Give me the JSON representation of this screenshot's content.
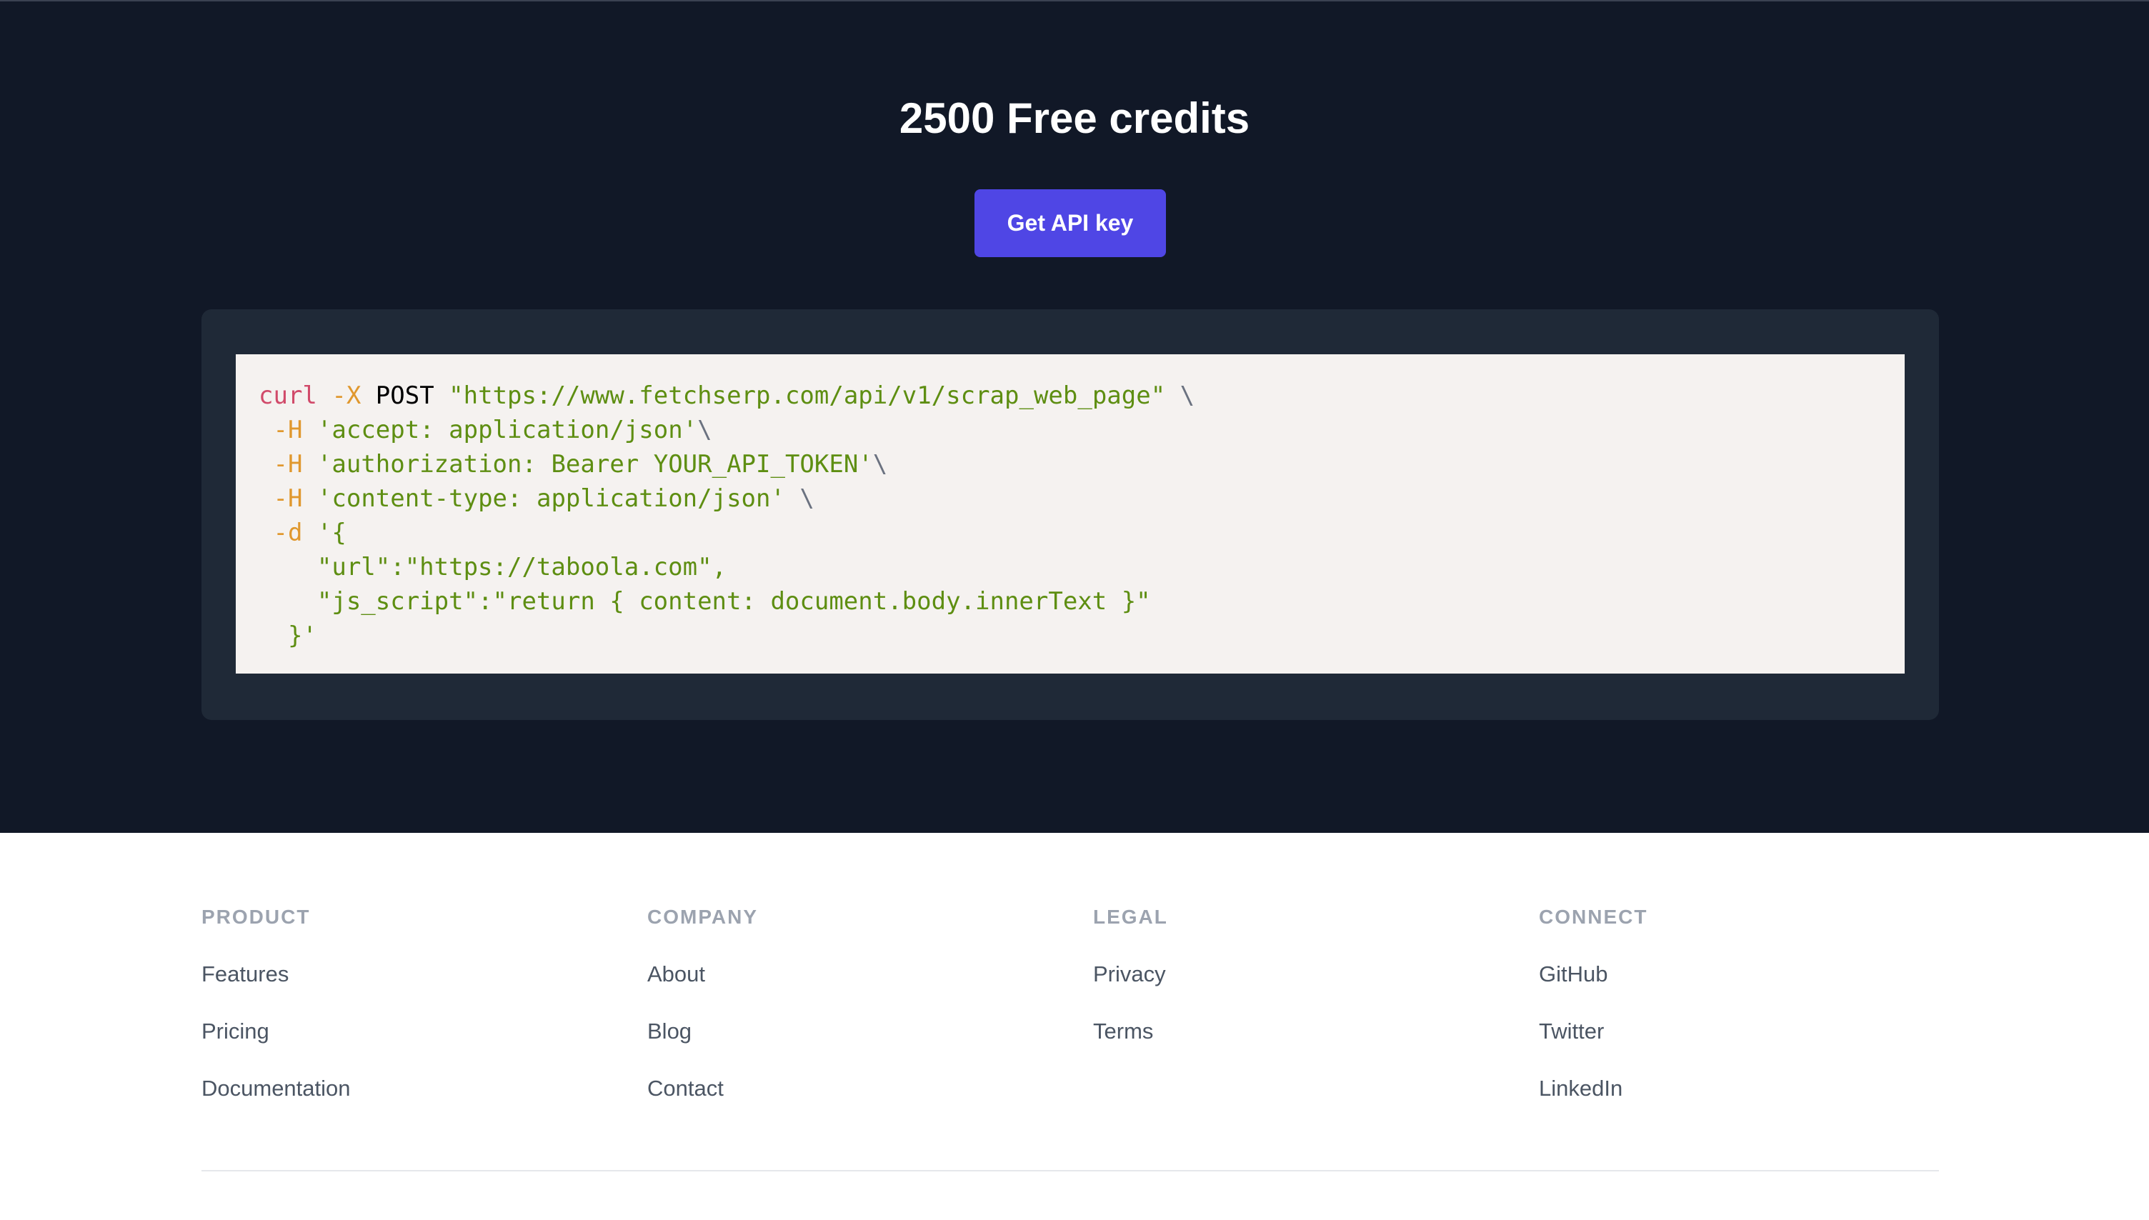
{
  "hero": {
    "title": "2500 Free credits",
    "cta_label": "Get API key"
  },
  "code": {
    "lines": [
      [
        {
          "t": "cmd",
          "v": "curl"
        },
        {
          "t": "kw",
          "v": " "
        },
        {
          "t": "flag",
          "v": "-X"
        },
        {
          "t": "kw",
          "v": " POST "
        },
        {
          "t": "str",
          "v": "\"https://www.fetchserp.com/api/v1/scrap_web_page\""
        },
        {
          "t": "punc",
          "v": " \\"
        }
      ],
      [
        {
          "t": "kw",
          "v": " "
        },
        {
          "t": "flag",
          "v": "-H"
        },
        {
          "t": "kw",
          "v": " "
        },
        {
          "t": "str",
          "v": "'accept: application/json'"
        },
        {
          "t": "punc",
          "v": "\\"
        }
      ],
      [
        {
          "t": "kw",
          "v": " "
        },
        {
          "t": "flag",
          "v": "-H"
        },
        {
          "t": "kw",
          "v": " "
        },
        {
          "t": "str",
          "v": "'authorization: Bearer YOUR_API_TOKEN'"
        },
        {
          "t": "punc",
          "v": "\\"
        }
      ],
      [
        {
          "t": "kw",
          "v": " "
        },
        {
          "t": "flag",
          "v": "-H"
        },
        {
          "t": "kw",
          "v": " "
        },
        {
          "t": "str",
          "v": "'content-type: application/json'"
        },
        {
          "t": "punc",
          "v": " \\"
        }
      ],
      [
        {
          "t": "kw",
          "v": " "
        },
        {
          "t": "flag",
          "v": "-d"
        },
        {
          "t": "kw",
          "v": " "
        },
        {
          "t": "str",
          "v": "'{"
        }
      ],
      [
        {
          "t": "str",
          "v": "    \"url\":\"https://taboola.com\","
        }
      ],
      [
        {
          "t": "str",
          "v": "    \"js_script\":\"return { content: document.body.innerText }\""
        }
      ],
      [
        {
          "t": "str",
          "v": "  }'"
        }
      ]
    ]
  },
  "footer": {
    "columns": [
      {
        "heading": "PRODUCT",
        "links": [
          "Features",
          "Pricing",
          "Documentation"
        ]
      },
      {
        "heading": "COMPANY",
        "links": [
          "About",
          "Blog",
          "Contact"
        ]
      },
      {
        "heading": "LEGAL",
        "links": [
          "Privacy",
          "Terms"
        ]
      },
      {
        "heading": "CONNECT",
        "links": [
          "GitHub",
          "Twitter",
          "LinkedIn"
        ]
      }
    ]
  },
  "colors": {
    "hero_bg": "#111827",
    "panel_bg": "#1f2937",
    "code_bg": "#f5f2f0",
    "accent": "#4f46e5",
    "code_cmd": "#d14a6a",
    "code_flag": "#e0982e",
    "code_string": "#5e8e12"
  }
}
